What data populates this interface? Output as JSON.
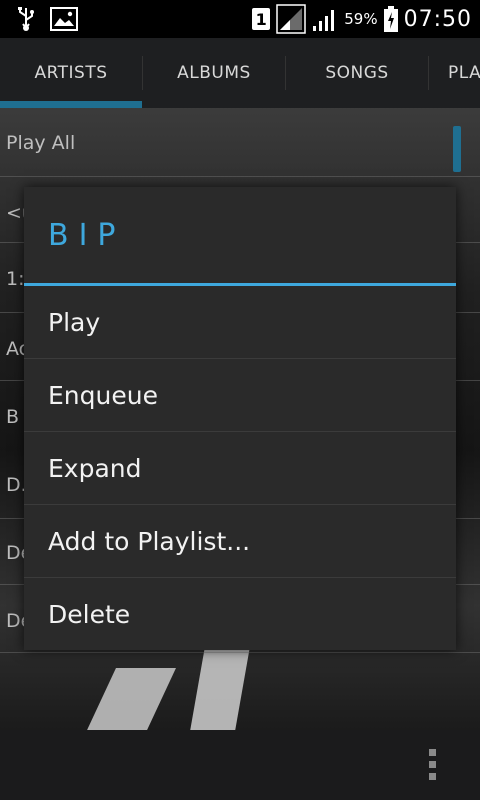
{
  "status_bar": {
    "sim_label": "1",
    "battery_percent": "59%",
    "time": "07:50",
    "icons": [
      "usb-icon",
      "image-icon",
      "sim-icon",
      "signal-icon",
      "signal-icon",
      "battery-icon"
    ]
  },
  "tabs": [
    {
      "label": "ARTISTS",
      "selected": true
    },
    {
      "label": "ALBUMS",
      "selected": false
    },
    {
      "label": "SONGS",
      "selected": false
    },
    {
      "label": "PLA",
      "selected": false
    }
  ],
  "background_list": {
    "play_all": "Play All",
    "rows": [
      "<u",
      "1:",
      "Ac",
      "B",
      "D.",
      "De",
      "De"
    ]
  },
  "dialog": {
    "title": "BIP",
    "items": [
      "Play",
      "Enqueue",
      "Expand",
      "Add to Playlist...",
      "Delete"
    ]
  },
  "colors": {
    "accent": "#3ea8dd",
    "tab_indicator": "#1f6f91",
    "dialog_bg": "#2a2a2a"
  }
}
